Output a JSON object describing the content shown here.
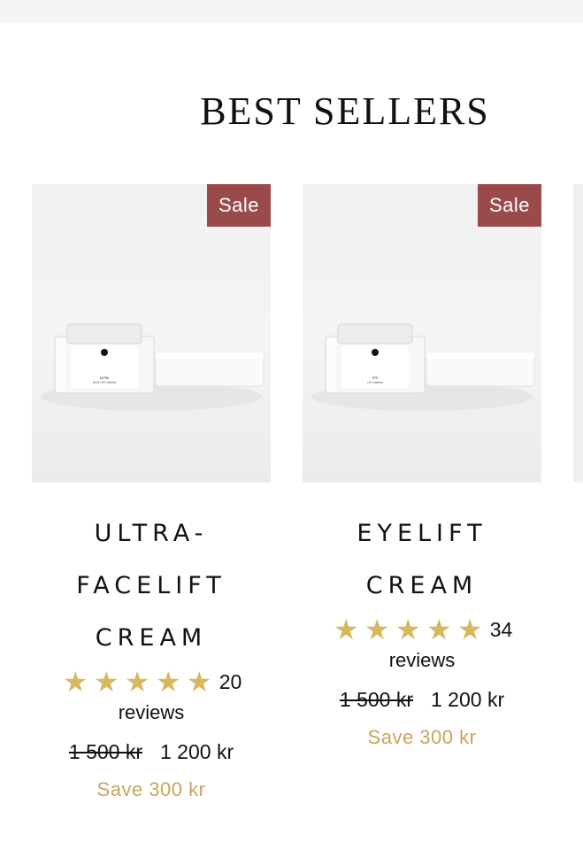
{
  "section": {
    "title": "BEST SELLERS"
  },
  "products": [
    {
      "badge": "Sale",
      "name_lines": [
        "ULTRA-",
        "FACELIFT",
        "CREAM"
      ],
      "jar_label_line1": "ULTRA",
      "jar_label_line2": "FACE LIFT CREAM",
      "stars": 5,
      "review_count": "20",
      "review_word": "reviews",
      "old_price": "1 500 kr",
      "new_price": "1 200 kr",
      "save_text": "Save 300 kr"
    },
    {
      "badge": "Sale",
      "name_lines": [
        "EYELIFT",
        "CREAM"
      ],
      "jar_label_line1": "EYE",
      "jar_label_line2": "LIFT CREAM",
      "stars": 5,
      "review_count": "34",
      "review_word": "reviews",
      "old_price": "1 500 kr",
      "new_price": "1 200 kr",
      "save_text": "Save 300 kr"
    }
  ],
  "colors": {
    "badge_bg": "#9a4a4a",
    "star": "#d7b85e",
    "save_text": "#c9a55a"
  },
  "icons": {
    "star": "star-icon"
  }
}
